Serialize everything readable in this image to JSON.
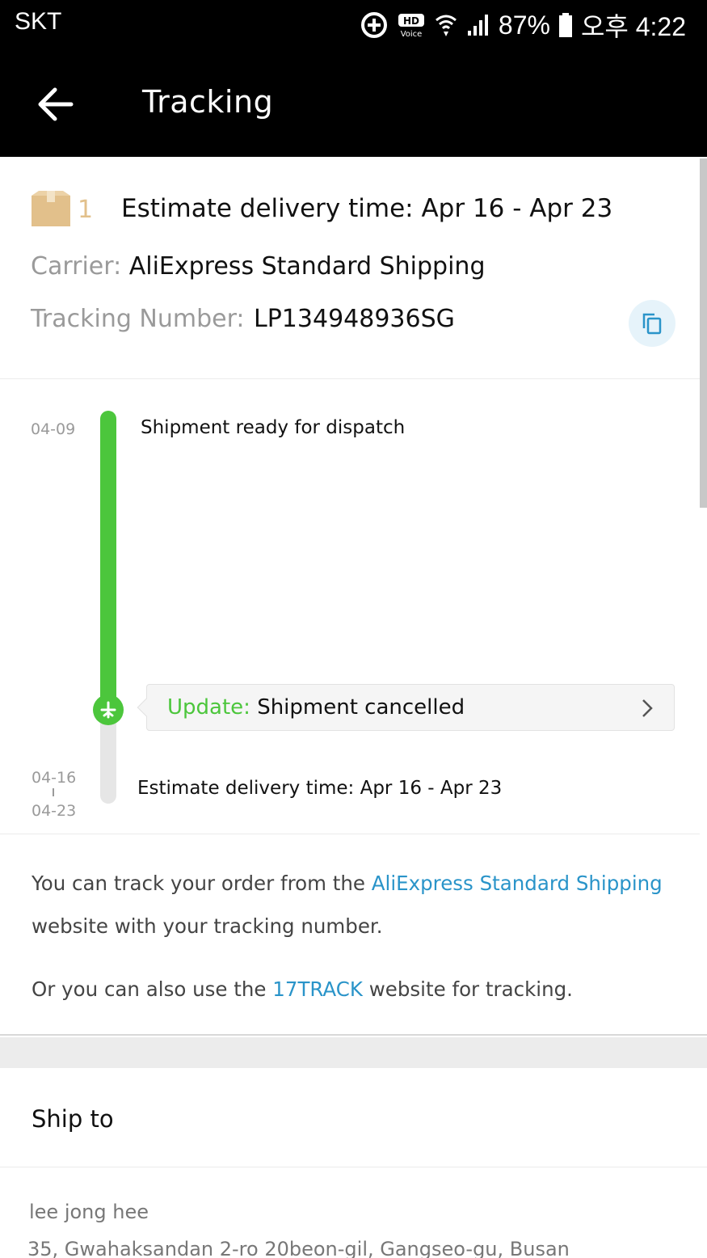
{
  "status_bar": {
    "carrier": "SKT",
    "battery": "87%",
    "time": "오후 4:22",
    "icons": [
      "data-saver-icon",
      "hd-voice-icon",
      "wifi-icon",
      "signal-icon",
      "battery-icon"
    ],
    "hd_label": "HD",
    "voice_label": "Voice"
  },
  "app_bar": {
    "title": "Tracking",
    "back_icon": "back-arrow-icon"
  },
  "summary": {
    "package_count": "1",
    "estimate": "Estimate delivery time: Apr 16 - Apr 23",
    "carrier_label": "Carrier:",
    "carrier_value": "AliExpress Standard Shipping",
    "tracking_label": "Tracking Number:",
    "tracking_value": "LP134948936SG",
    "copy_icon": "copy-icon"
  },
  "timeline": {
    "events": [
      {
        "date": "04-09",
        "text": "Shipment ready for dispatch"
      }
    ],
    "update_label": "Update:",
    "update_text": "Shipment cancelled",
    "estimate_date_start": "04-16",
    "estimate_date_end": "04-23",
    "estimate_text": "Estimate delivery time: Apr 16 - Apr 23",
    "colors": {
      "progress": "#4cc63c",
      "pending": "#e6e6e6"
    }
  },
  "info": {
    "line1_prefix": "You can track your order from the ",
    "line1_link": "AliExpress Standard Shipping",
    "line2": "website with your tracking number.",
    "line3_prefix": "Or you can also use the ",
    "line3_link": "17TRACK",
    "line3_suffix": " website for tracking.",
    "link_color": "#2a94c9"
  },
  "ship_to": {
    "title": "Ship to",
    "name": "lee jong hee",
    "address": "35, Gwahaksandan 2-ro 20beon-gil, Gangseo-gu, Busan"
  }
}
